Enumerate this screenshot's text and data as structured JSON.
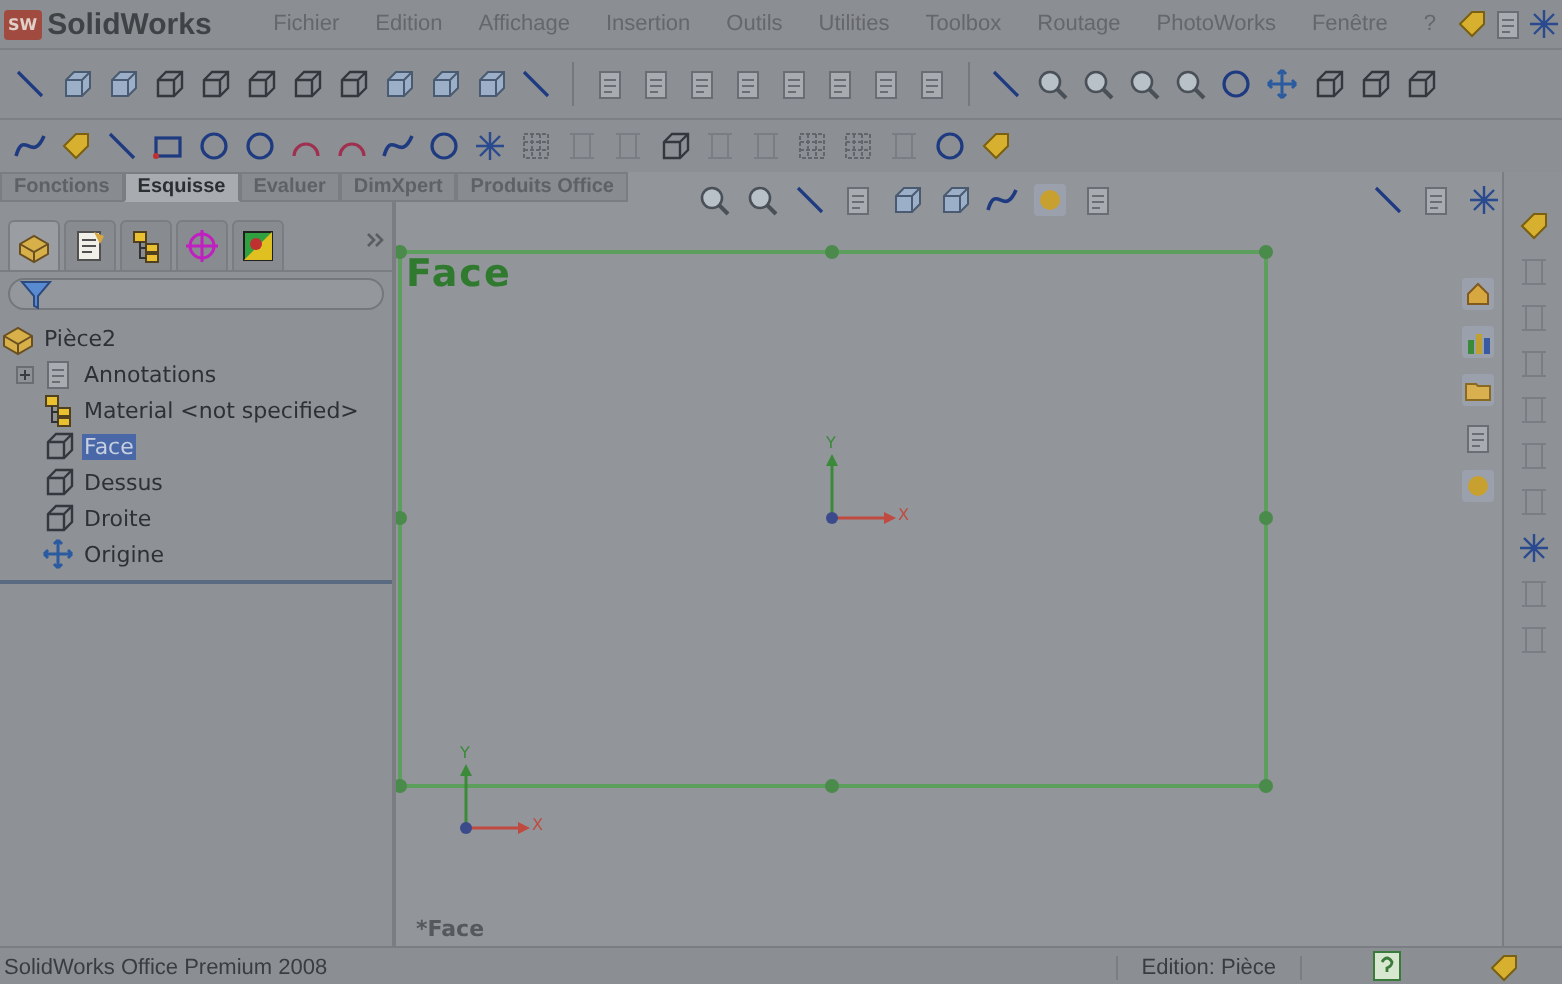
{
  "app": {
    "logo_badge": "SW",
    "logo": "SolidWorks"
  },
  "menu": [
    {
      "label": "Fichier"
    },
    {
      "label": "Edition"
    },
    {
      "label": "Affichage"
    },
    {
      "label": "Insertion"
    },
    {
      "label": "Outils"
    },
    {
      "label": "Utilities"
    },
    {
      "label": "Toolbox"
    },
    {
      "label": "Routage"
    },
    {
      "label": "PhotoWorks"
    },
    {
      "label": "Fenêtre"
    },
    {
      "label": "?"
    }
  ],
  "command_tabs": [
    {
      "label": "Fonctions",
      "selected": false
    },
    {
      "label": "Esquisse",
      "selected": true
    },
    {
      "label": "Evaluer",
      "selected": false
    },
    {
      "label": "DimXpert",
      "selected": false
    },
    {
      "label": "Produits Office",
      "selected": false
    }
  ],
  "panel_tabs": [
    {
      "selected": true
    },
    {
      "selected": false
    },
    {
      "selected": false
    },
    {
      "selected": false
    },
    {
      "selected": false
    }
  ],
  "tree": {
    "label": "Pièce2",
    "children": [
      {
        "label": "Annotations",
        "kind": "annotations",
        "expanded": false,
        "selected": false
      },
      {
        "label": "Material <not specified>",
        "kind": "material",
        "selected": false
      },
      {
        "label": "Face",
        "kind": "plane",
        "selected": true
      },
      {
        "label": "Dessus",
        "kind": "plane",
        "selected": false
      },
      {
        "label": "Droite",
        "kind": "plane",
        "selected": false
      },
      {
        "label": "Origine",
        "kind": "origin",
        "selected": false
      }
    ]
  },
  "viewport": {
    "sketch_label": "Face",
    "axes": [
      {
        "x": "X",
        "y": "Y"
      },
      {
        "x": "X",
        "y": "Y"
      }
    ],
    "view_name": "*Face"
  },
  "status_bar": {
    "product": "SolidWorks Office Premium 2008",
    "mode": "Edition: Pièce"
  }
}
